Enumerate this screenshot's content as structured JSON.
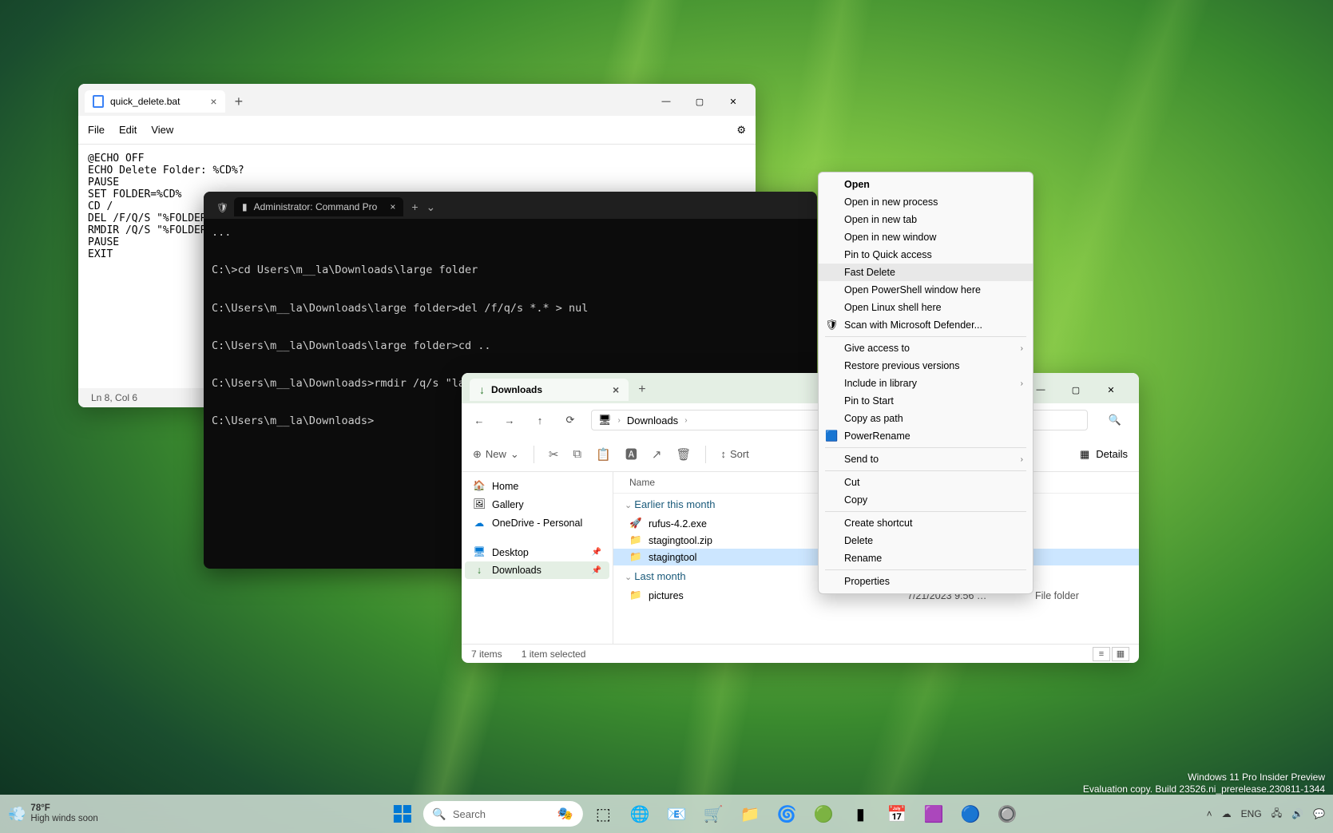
{
  "notepad": {
    "tab_title": "quick_delete.bat",
    "menu": {
      "file": "File",
      "edit": "Edit",
      "view": "View"
    },
    "content": "@ECHO OFF\nECHO Delete Folder: %CD%?\nPAUSE\nSET FOLDER=%CD%\nCD /\nDEL /F/Q/S \"%FOLDER%\" > NUL\nRMDIR /Q/S \"%FOLDER%\"\nPAUSE\nEXIT",
    "status": "Ln 8, Col 6"
  },
  "terminal": {
    "tab_title": "Administrator: Command Pro",
    "lines": "...\n\nC:\\>cd Users\\m__la\\Downloads\\large folder\n\nC:\\Users\\m__la\\Downloads\\large folder>del /f/q/s *.* > nul\n\nC:\\Users\\m__la\\Downloads\\large folder>cd ..\n\nC:\\Users\\m__la\\Downloads>rmdir /q/s \"large folder\"\n\nC:\\Users\\m__la\\Downloads>"
  },
  "explorer": {
    "tab_title": "Downloads",
    "breadcrumb": "Downloads",
    "toolbar": {
      "new": "New",
      "sort": "Sort",
      "details": "Details"
    },
    "sidebar": {
      "home": "Home",
      "gallery": "Gallery",
      "onedrive": "OneDrive - Personal",
      "desktop": "Desktop",
      "downloads": "Downloads"
    },
    "columns": {
      "name": "Name"
    },
    "group1": "Earlier this month",
    "group2": "Last month",
    "rows": [
      {
        "name": "rufus-4.2.exe",
        "icon": "🚀",
        "date": "",
        "type": ""
      },
      {
        "name": "stagingtool.zip",
        "icon": "📁",
        "date": "",
        "type": ""
      },
      {
        "name": "stagingtool",
        "icon": "📁",
        "date": "",
        "type": "",
        "selected": true
      },
      {
        "name": "pictures",
        "icon": "📁",
        "date": "7/21/2023 9:56 …",
        "type": "File folder"
      }
    ],
    "status": {
      "count": "7 items",
      "selected": "1 item selected"
    }
  },
  "context_menu": {
    "items": [
      {
        "label": "Open",
        "bold": true
      },
      {
        "label": "Open in new process"
      },
      {
        "label": "Open in new tab"
      },
      {
        "label": "Open in new window"
      },
      {
        "label": "Pin to Quick access"
      },
      {
        "label": "Fast Delete",
        "hover": true
      },
      {
        "label": "Open PowerShell window here"
      },
      {
        "label": "Open Linux shell here"
      },
      {
        "label": "Scan with Microsoft Defender...",
        "icon": "🛡"
      },
      {
        "sep": true
      },
      {
        "label": "Give access to",
        "sub": true
      },
      {
        "label": "Restore previous versions"
      },
      {
        "label": "Include in library",
        "sub": true
      },
      {
        "label": "Pin to Start"
      },
      {
        "label": "Copy as path"
      },
      {
        "label": "PowerRename",
        "icon": "🟦"
      },
      {
        "sep": true
      },
      {
        "label": "Send to",
        "sub": true
      },
      {
        "sep": true
      },
      {
        "label": "Cut"
      },
      {
        "label": "Copy"
      },
      {
        "sep": true
      },
      {
        "label": "Create shortcut"
      },
      {
        "label": "Delete"
      },
      {
        "label": "Rename"
      },
      {
        "sep": true
      },
      {
        "label": "Properties"
      }
    ]
  },
  "watermark": {
    "line1": "Windows 11 Pro Insider Preview",
    "line2": "Evaluation copy. Build 23526.ni_prerelease.230811-1344"
  },
  "taskbar": {
    "weather_temp": "78°F",
    "weather_desc": "High winds soon",
    "search_placeholder": "Search",
    "lang": "ENG"
  }
}
